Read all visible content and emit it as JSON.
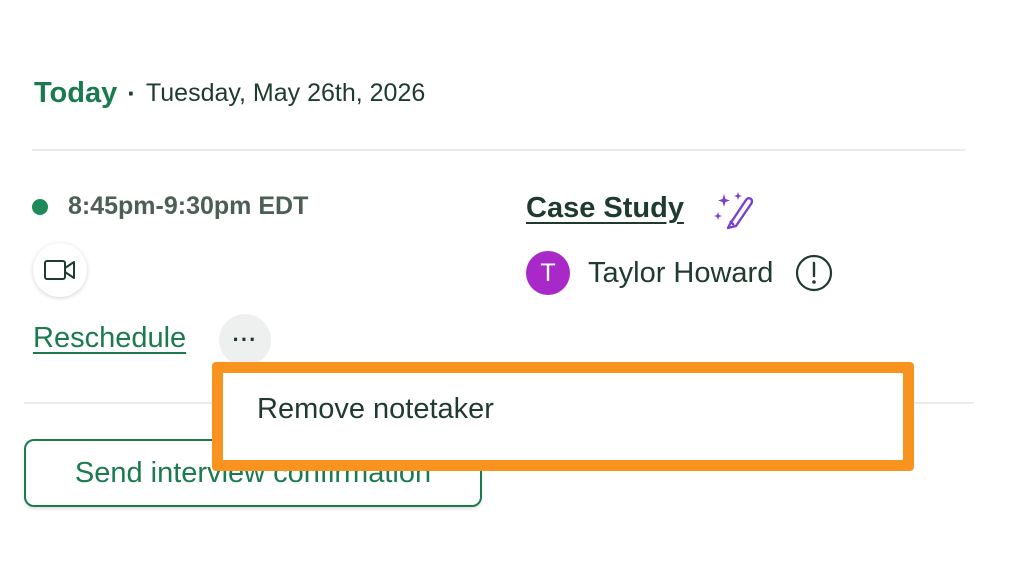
{
  "header": {
    "today_label": "Today",
    "separator": "·",
    "date": "Tuesday, May 26th, 2026"
  },
  "interview": {
    "time_range": "8:45pm-9:30pm EDT",
    "status_color": "#1c8a5a",
    "reschedule_label": "Reschedule",
    "more_label": "···",
    "title": "Case Study",
    "ai_icon": "sparkle-pen-icon",
    "interviewer": {
      "initial": "T",
      "name": "Taylor Howard",
      "avatar_color": "#a829c8"
    }
  },
  "actions": {
    "send_confirmation_label": "Send interview confirmation"
  },
  "dropdown": {
    "items": [
      {
        "label": "Remove notetaker"
      }
    ],
    "highlight_color": "#f7931e"
  },
  "colors": {
    "accent": "#1c7a4f",
    "text": "#1f3a2e",
    "ai_purple": "#7b3fd0"
  }
}
